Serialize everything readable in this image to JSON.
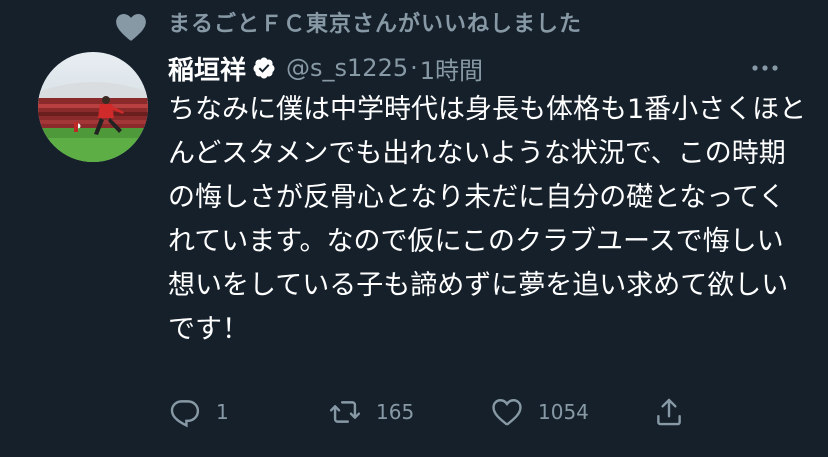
{
  "social_context": {
    "text": "まるごとＦＣ東京さんがいいねしました",
    "icon": "heart-icon"
  },
  "author": {
    "display_name": "稲垣祥",
    "handle": "@s_s1225",
    "separator": "·",
    "time": "1時間",
    "verified_icon": "verified-badge-icon"
  },
  "tweet": {
    "text": "ちなみに僕は中学時代は身長も体格も1番小さくほとんどスタメンでも出れないような状況で、この時期の悔しさが反骨心となり未だに自分の礎となってくれています。なので仮にこのクラブユースで悔しい想いをしている子も諦めずに夢を追い求めて欲しいです！"
  },
  "actions": {
    "reply_count": "1",
    "retweet_count": "165",
    "like_count": "1054"
  },
  "colors": {
    "background": "#15202b",
    "secondary_text": "#8899a6",
    "primary_text": "#ffffff"
  }
}
